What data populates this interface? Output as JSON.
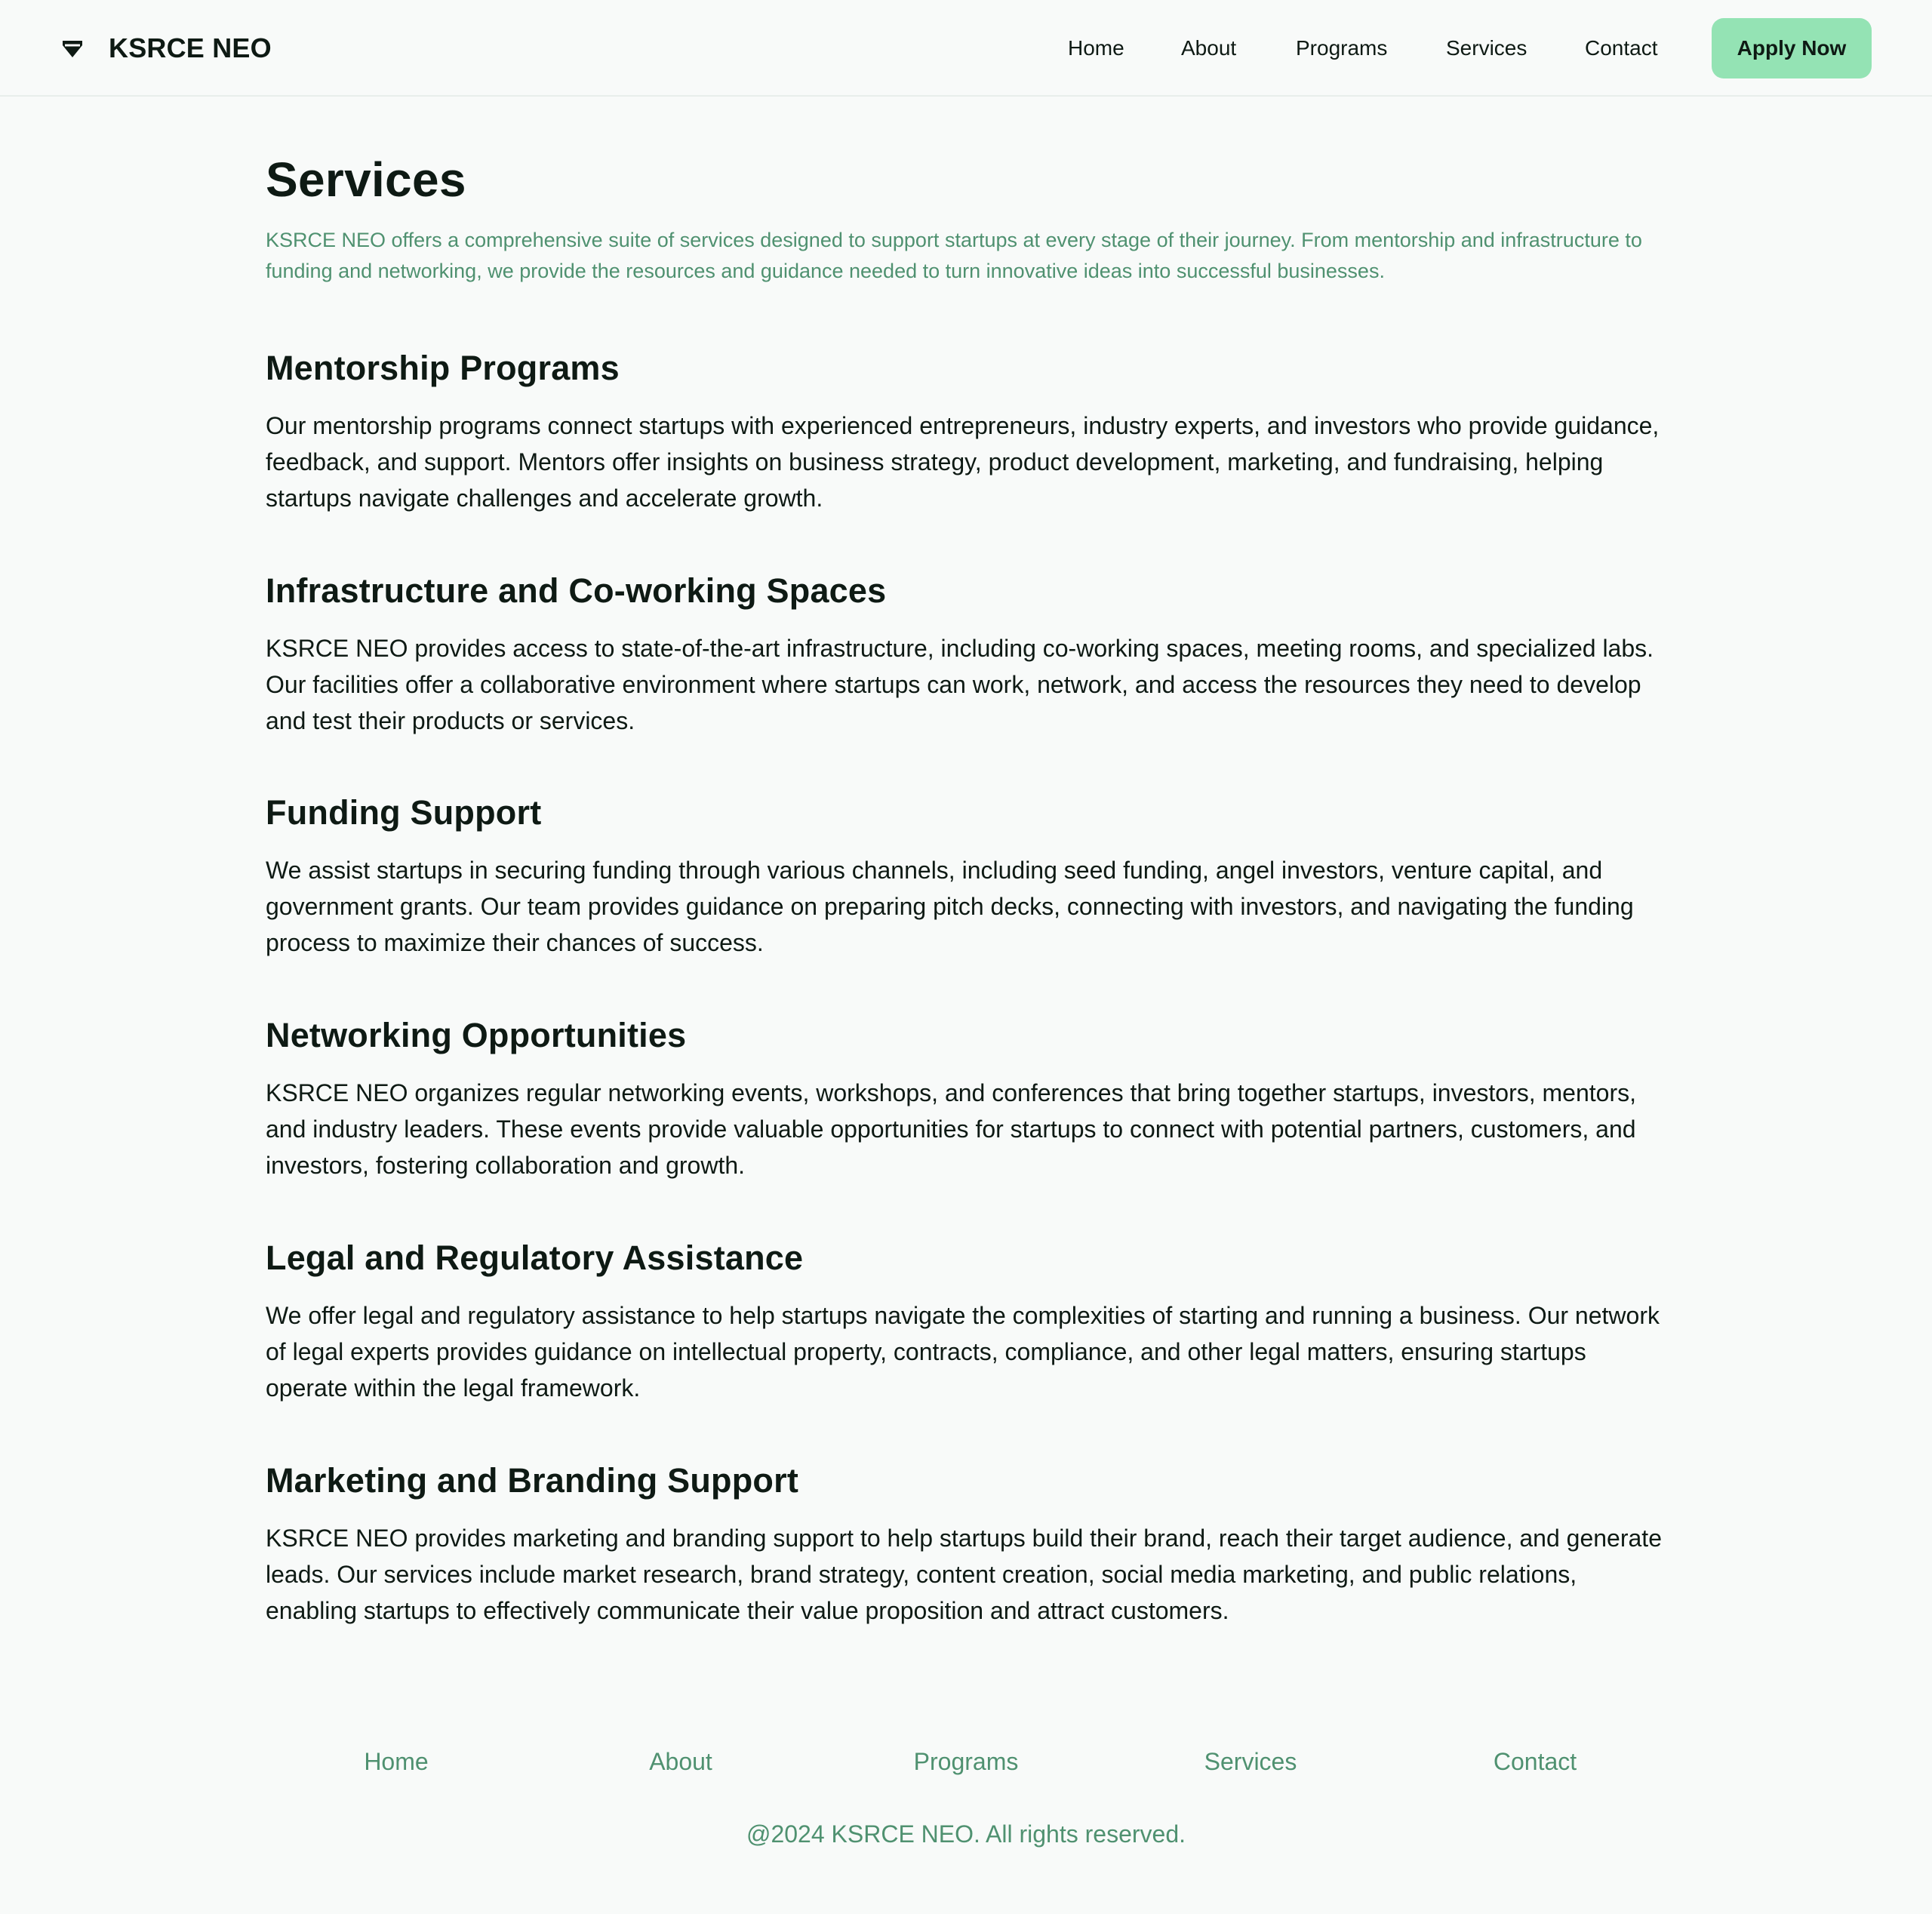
{
  "header": {
    "brand_name": "KSRCE NEO",
    "brand_icon": "diamond-logo-icon",
    "nav": [
      "Home",
      "About",
      "Programs",
      "Services",
      "Contact"
    ],
    "cta_label": "Apply Now"
  },
  "page": {
    "title": "Services",
    "intro": "KSRCE NEO offers a comprehensive suite of services designed to support startups at every stage of their journey. From mentorship and infrastructure to funding and networking, we provide the resources and guidance needed to turn innovative ideas into successful businesses."
  },
  "services": [
    {
      "title": "Mentorship Programs",
      "body": "Our mentorship programs connect startups with experienced entrepreneurs, industry experts, and investors who provide guidance, feedback, and support. Mentors offer insights on business strategy, product development, marketing, and fundraising, helping startups navigate challenges and accelerate growth."
    },
    {
      "title": "Infrastructure and Co-working Spaces",
      "body": "KSRCE NEO provides access to state-of-the-art infrastructure, including co-working spaces, meeting rooms, and specialized labs. Our facilities offer a collaborative environment where startups can work, network, and access the resources they need to develop and test their products or services."
    },
    {
      "title": "Funding Support",
      "body": "We assist startups in securing funding through various channels, including seed funding, angel investors, venture capital, and government grants. Our team provides guidance on preparing pitch decks, connecting with investors, and navigating the funding process to maximize their chances of success."
    },
    {
      "title": "Networking Opportunities",
      "body": "KSRCE NEO organizes regular networking events, workshops, and conferences that bring together startups, investors, mentors, and industry leaders. These events provide valuable opportunities for startups to connect with potential partners, customers, and investors, fostering collaboration and growth."
    },
    {
      "title": "Legal and Regulatory Assistance",
      "body": "We offer legal and regulatory assistance to help startups navigate the complexities of starting and running a business. Our network of legal experts provides guidance on intellectual property, contracts, compliance, and other legal matters, ensuring startups operate within the legal framework."
    },
    {
      "title": "Marketing and Branding Support",
      "body": "KSRCE NEO provides marketing and branding support to help startups build their brand, reach their target audience, and generate leads. Our services include market research, brand strategy, content creation, social media marketing, and public relations, enabling startups to effectively communicate their value proposition and attract customers."
    }
  ],
  "footer": {
    "links": [
      "Home",
      "About",
      "Programs",
      "Services",
      "Contact"
    ],
    "copyright": "@2024 KSRCE NEO. All rights reserved."
  },
  "colors": {
    "background": "#f8faf9",
    "accent": "#94e3b4",
    "muted_green": "#4f9170",
    "text": "#0e1a14"
  }
}
